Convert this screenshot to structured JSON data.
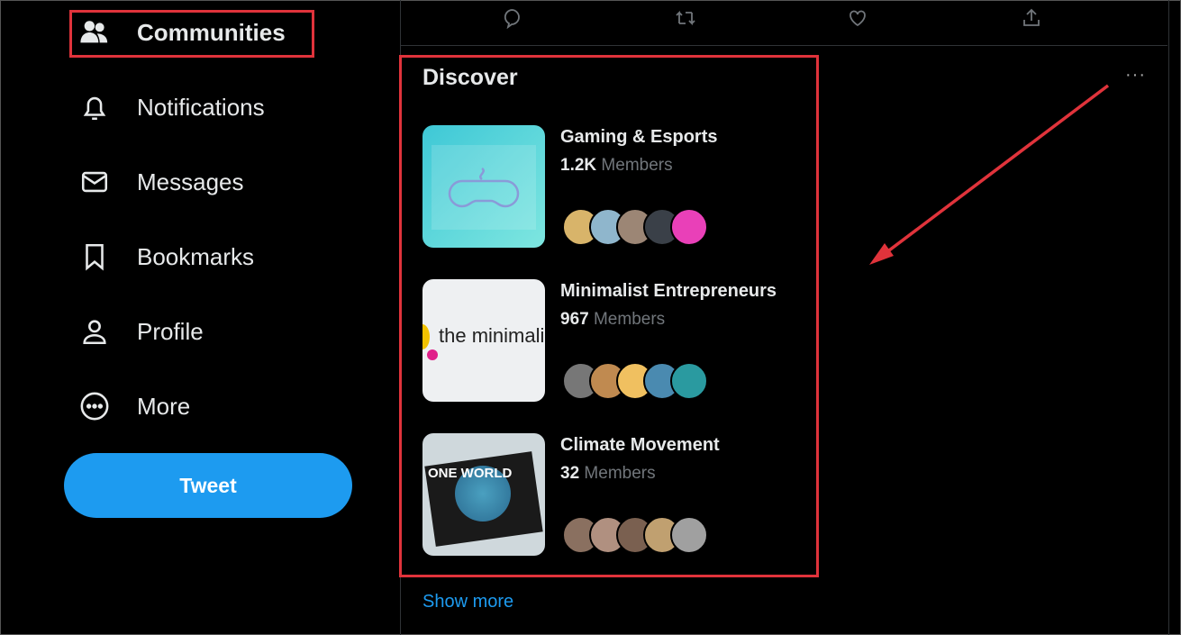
{
  "nav": {
    "items": [
      {
        "label": "Communities",
        "icon": "communities-icon"
      },
      {
        "label": "Notifications",
        "icon": "bell-icon"
      },
      {
        "label": "Messages",
        "icon": "envelope-icon"
      },
      {
        "label": "Bookmarks",
        "icon": "bookmark-icon"
      },
      {
        "label": "Profile",
        "icon": "person-icon"
      },
      {
        "label": "More",
        "icon": "more-circle-icon"
      }
    ],
    "tweet_label": "Tweet"
  },
  "discover": {
    "title": "Discover",
    "more": "···",
    "show_more": "Show more",
    "communities": [
      {
        "name": "Gaming & Esports",
        "count": "1.2K",
        "members_label": "Members"
      },
      {
        "name": "Minimalist Entrepreneurs",
        "count": "967",
        "members_label": "Members",
        "thumb_text": "the minimalist entrepreneur"
      },
      {
        "name": "Climate Movement",
        "count": "32",
        "members_label": "Members",
        "thumb_text": "ONE WORLD"
      }
    ]
  },
  "colors": {
    "accent": "#1d9bf0",
    "highlight": "#e0333b"
  }
}
